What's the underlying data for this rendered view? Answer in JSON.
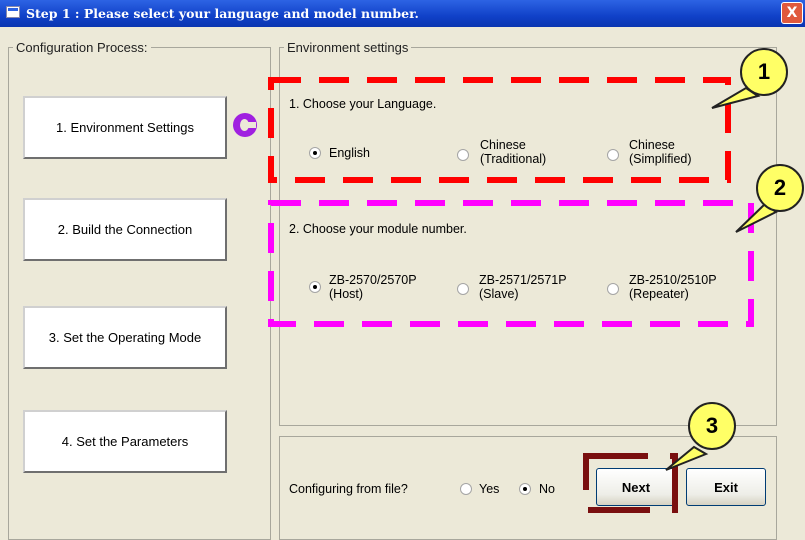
{
  "window": {
    "title": "Step 1 : Please select your language and model number.",
    "close_label": "X"
  },
  "process": {
    "legend": "Configuration Process:",
    "steps": [
      {
        "label": "1. Environment Settings"
      },
      {
        "label": "2. Build the Connection"
      },
      {
        "label": "3. Set the Operating Mode"
      },
      {
        "label": "4. Set the Parameters"
      }
    ],
    "current_step_icon": "arrow-icon"
  },
  "environment": {
    "legend": "Environment settings",
    "language": {
      "prompt": "1. Choose your Language.",
      "options": [
        {
          "line1": "English",
          "line2": "",
          "selected": true
        },
        {
          "line1": "Chinese",
          "line2": "(Traditional)",
          "selected": false
        },
        {
          "line1": "Chinese",
          "line2": "(Simplified)",
          "selected": false
        }
      ]
    },
    "module": {
      "prompt": "2. Choose your module number.",
      "options": [
        {
          "line1": "ZB-2570/2570P",
          "line2": "(Host)",
          "selected": true
        },
        {
          "line1": "ZB-2571/2571P",
          "line2": "(Slave)",
          "selected": false
        },
        {
          "line1": "ZB-2510/2510P",
          "line2": "(Repeater)",
          "selected": false
        }
      ]
    }
  },
  "config_file": {
    "question": "Configuring from file?",
    "yes_label": "Yes",
    "no_label": "No",
    "selected": "No"
  },
  "buttons": {
    "next": "Next",
    "exit": "Exit"
  },
  "annotations": {
    "callout_1": "1",
    "callout_2": "2",
    "callout_3": "3"
  },
  "colors": {
    "title_bar": "#1041c8",
    "callout_1_box": "#ff0000",
    "callout_2_box": "#ff00ff",
    "callout_3_box": "#7a0f0f",
    "callout_fill": "#ffff66"
  }
}
